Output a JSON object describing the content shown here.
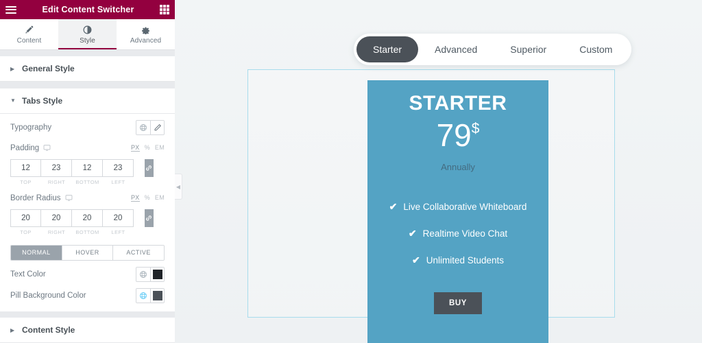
{
  "panel": {
    "header": {
      "title": "Edit Content Switcher",
      "menu_icon": "hamburger-icon",
      "apps_icon": "grid-apps-icon"
    },
    "tabs": [
      {
        "label": "Content",
        "icon": "pencil-icon",
        "active": false
      },
      {
        "label": "Style",
        "icon": "contrast-circle-icon",
        "active": true
      },
      {
        "label": "Advanced",
        "icon": "gear-icon",
        "active": false
      }
    ],
    "sections": [
      {
        "title": "General Style",
        "expanded": false
      },
      {
        "title": "Tabs Style",
        "expanded": true
      },
      {
        "title": "Content Style",
        "expanded": false
      }
    ],
    "controls": {
      "typography": {
        "label": "Typography",
        "globe_icon": "globe-icon",
        "edit_icon": "pencil-edit-icon"
      },
      "padding": {
        "label": "Padding",
        "device_icon": "desktop-icon",
        "units": [
          "PX",
          "%",
          "EM"
        ],
        "unit_active": "PX",
        "values": [
          "12",
          "23",
          "12",
          "23"
        ],
        "sublabels": [
          "TOP",
          "RIGHT",
          "BOTTOM",
          "LEFT"
        ],
        "link_icon": "link-icon"
      },
      "border_radius": {
        "label": "Border Radius",
        "device_icon": "desktop-icon",
        "units": [
          "PX",
          "%",
          "EM"
        ],
        "unit_active": "PX",
        "values": [
          "20",
          "20",
          "20",
          "20"
        ],
        "sublabels": [
          "TOP",
          "RIGHT",
          "BOTTOM",
          "LEFT"
        ],
        "link_icon": "link-icon"
      },
      "states": {
        "options": [
          "NORMAL",
          "HOVER",
          "ACTIVE"
        ],
        "selected": "NORMAL"
      },
      "text_color": {
        "label": "Text Color",
        "globe_icon": "globe-icon",
        "globe_active": false,
        "swatch": "#1f2328"
      },
      "pill_background_color": {
        "label": "Pill Background Color",
        "globe_icon": "globe-icon",
        "globe_active": true,
        "swatch": "#4b5158"
      }
    },
    "collapse_handle_icon": "chevron-left-icon"
  },
  "canvas": {
    "switcher": {
      "tabs": [
        {
          "label": "Starter",
          "active": true
        },
        {
          "label": "Advanced",
          "active": false
        },
        {
          "label": "Superior",
          "active": false
        },
        {
          "label": "Custom",
          "active": false
        }
      ],
      "active_pill_color": "#4b5158"
    },
    "card": {
      "title": "STARTER",
      "price": "79",
      "currency": "$",
      "period": "Annually",
      "background_color": "#54a3c4",
      "features": [
        {
          "check_icon": "check-icon",
          "label": "Live Collaborative Whiteboard"
        },
        {
          "check_icon": "check-icon",
          "label": "Realtime Video Chat"
        },
        {
          "check_icon": "check-icon",
          "label": "Unlimited Students"
        }
      ],
      "buy_label": "BUY",
      "buy_color": "#4b5158"
    },
    "selection_border_color": "#a7dcec"
  }
}
